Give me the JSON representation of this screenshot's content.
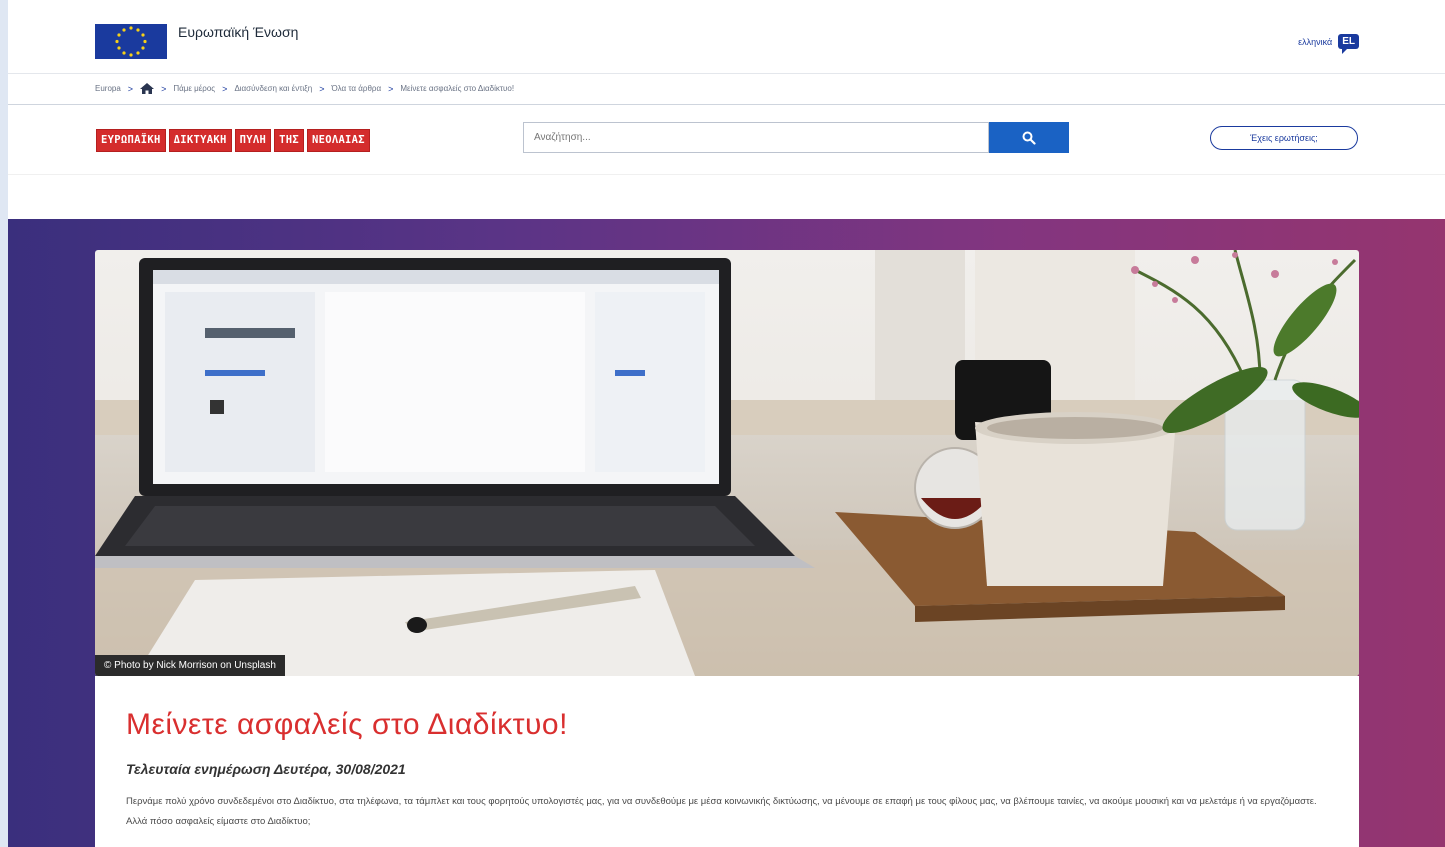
{
  "eu": {
    "name": "Ευρωπαϊκή Ένωση"
  },
  "language": {
    "label": "ελληνικά",
    "code": "EL"
  },
  "breadcrumb": {
    "items": [
      "Europa",
      "Πάμε μέρος",
      "Διασύνδεση και έντιξη",
      "Όλα τα άρθρα",
      "Μείνετε ασφαλείς στο Διαδίκτυο!"
    ]
  },
  "portal": {
    "logo_words": [
      "ΕΥΡΩΠΑΪΚΗ",
      "ΔΙΚΤΥΑΚΗ",
      "ΠΥΛΗ",
      "ΤΗΣ",
      "ΝΕΟΛΑΙΑΣ"
    ]
  },
  "search": {
    "placeholder": "Αναζήτηση..."
  },
  "questions_button": "Έχεις ερωτήσεις;",
  "hero": {
    "photo_credit": "© Photo by Nick Morrison on Unsplash"
  },
  "article": {
    "title": "Μείνετε ασφαλείς στο Διαδίκτυο!",
    "updated": "Τελευταία ενημέρωση Δευτέρα, 30/08/2021",
    "intro": "Περνάμε πολύ χρόνο συνδεδεμένοι στο Διαδίκτυο, στα τηλέφωνα, τα τάμπλετ και τους φορητούς υπολογιστές μας, για να συνδεθούμε με μέσα κοινωνικής δικτύωσης, να μένουμε σε επαφή με τους φίλους μας, να βλέπουμε ταινίες, να ακούμε μουσική και να μελετάμε ή να εργαζόμαστε. Αλλά πόσο ασφαλείς είμαστε στο Διαδίκτυο;"
  },
  "colors": {
    "accent_red": "#d92f2f",
    "eu_blue": "#1a3a9e",
    "search_blue": "#1a62c4"
  },
  "icons": {
    "home": "home-icon",
    "search": "search-icon"
  }
}
